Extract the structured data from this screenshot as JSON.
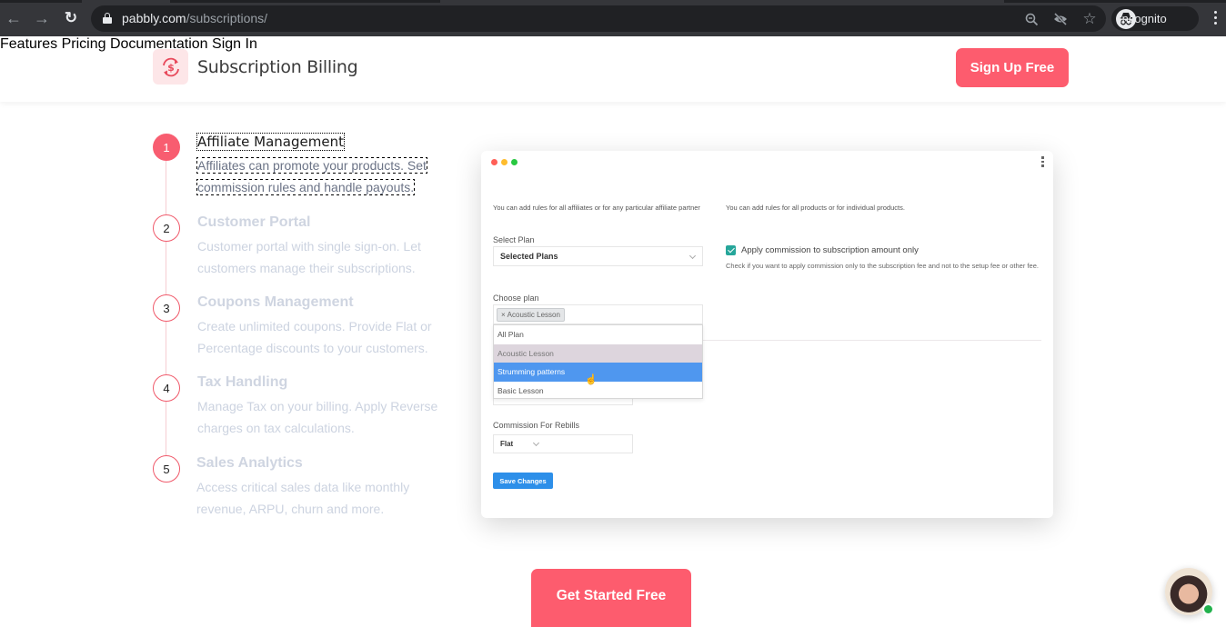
{
  "browser": {
    "url_host": "pabbly.com",
    "url_path": "/subscriptions/",
    "profile_label": "Incognito",
    "icons": [
      "back-icon",
      "forward-icon",
      "reload-icon",
      "lock-icon",
      "zoom-icon",
      "tracking-blocked-eye-icon",
      "bookmark-star-icon",
      "incognito-icon",
      "menu-kebab-icon"
    ]
  },
  "header": {
    "brand_name": "Subscription Billing",
    "brand_icon": "dollar-cycle-icon",
    "nav": [
      {
        "label": "Features"
      },
      {
        "label": "Pricing"
      },
      {
        "label": "Documentation"
      },
      {
        "label": "Sign In"
      }
    ],
    "cta_label": "Sign Up Free",
    "accent_color": "#fd5c6e"
  },
  "steps": [
    {
      "number": "1",
      "title": "Affiliate Management",
      "description": "Affiliates can promote your products. Set commission rules and handle payouts.",
      "active": true
    },
    {
      "number": "2",
      "title": "Customer Portal",
      "description": "Customer portal with single sign-on. Let customers manage their subscriptions.",
      "active": false
    },
    {
      "number": "3",
      "title": "Coupons Management",
      "description": "Create unlimited coupons. Provide Flat or Percentage discounts to your customers.",
      "active": false
    },
    {
      "number": "4",
      "title": "Tax Handling",
      "description": "Manage Tax on your billing. Apply Reverse charges on tax calculations.",
      "active": false
    },
    {
      "number": "5",
      "title": "Sales Analytics",
      "description": "Access critical sales data like monthly revenue, ARPU, churn and more.",
      "active": false
    }
  ],
  "preview": {
    "left_hint": "You can add rules for all affiliates or for any particular affiliate partner",
    "right_hint": "You can add rules for all products or for individual products.",
    "select_plan_label": "Select Plan",
    "select_plan_value": "Selected Plans",
    "checkbox_label": "Apply commission to subscription amount only",
    "checkbox_checked": true,
    "checkbox_help": "Check if you want to apply commission only to the subscription fee and not to the setup fee or other fee.",
    "choose_plan_label": "Choose plan",
    "chip_label": "Acoustic Lesson",
    "dropdown_options": [
      {
        "label": "All Plan",
        "state": "normal"
      },
      {
        "label": "Acoustic Lesson",
        "state": "selected"
      },
      {
        "label": "Strumming patterns",
        "state": "hover"
      },
      {
        "label": "Basic Lesson",
        "state": "normal"
      }
    ],
    "rebills_label": "Commission For Rebills",
    "rebills_value": "Flat",
    "save_label": "Save Changes",
    "window_dots": [
      "#ff5f57",
      "#febc2e",
      "#28c840"
    ]
  },
  "cta": {
    "label": "Get Started Free"
  },
  "chat": {
    "status": "online"
  }
}
